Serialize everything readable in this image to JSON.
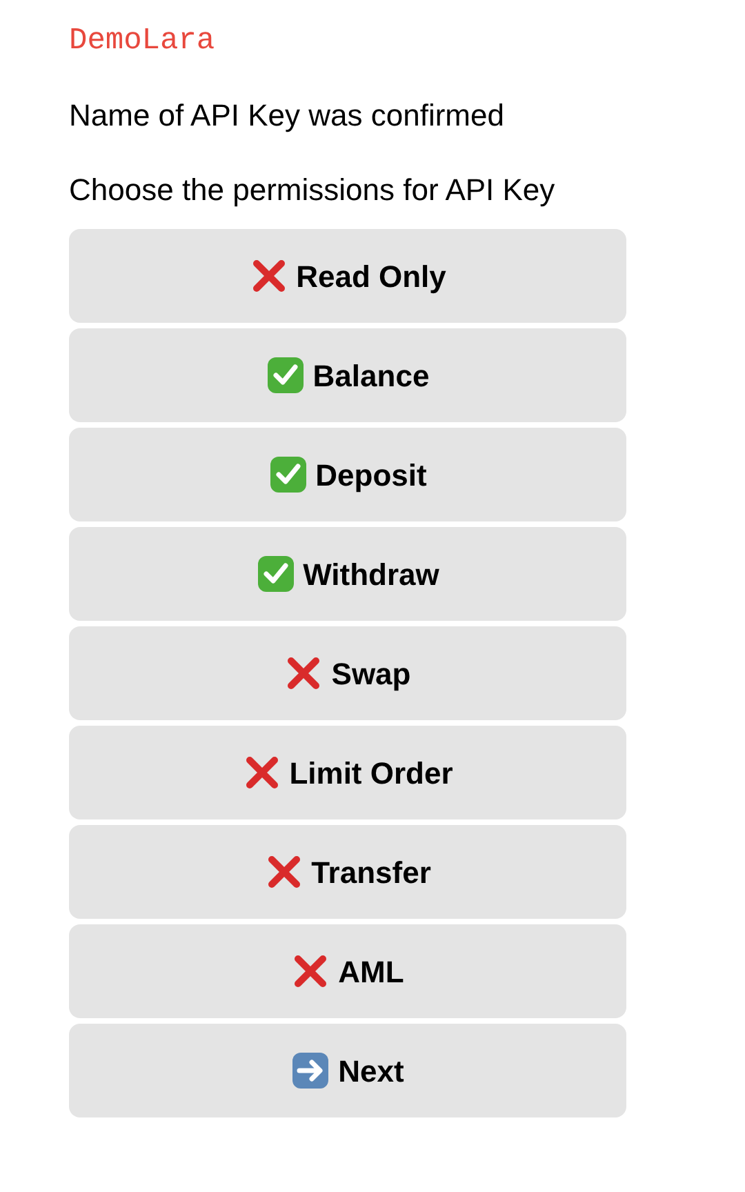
{
  "sender": "DemoLara",
  "messages": [
    "Name of API Key was confirmed",
    "Choose the permissions for API Key"
  ],
  "buttons": [
    {
      "kind": "toggle",
      "label": "Read Only",
      "checked": false
    },
    {
      "kind": "toggle",
      "label": "Balance",
      "checked": true
    },
    {
      "kind": "toggle",
      "label": "Deposit",
      "checked": true
    },
    {
      "kind": "toggle",
      "label": "Withdraw",
      "checked": true
    },
    {
      "kind": "toggle",
      "label": "Swap",
      "checked": false
    },
    {
      "kind": "toggle",
      "label": "Limit Order",
      "checked": false
    },
    {
      "kind": "toggle",
      "label": "Transfer",
      "checked": false
    },
    {
      "kind": "toggle",
      "label": "AML",
      "checked": false
    },
    {
      "kind": "next",
      "label": "Next"
    }
  ]
}
